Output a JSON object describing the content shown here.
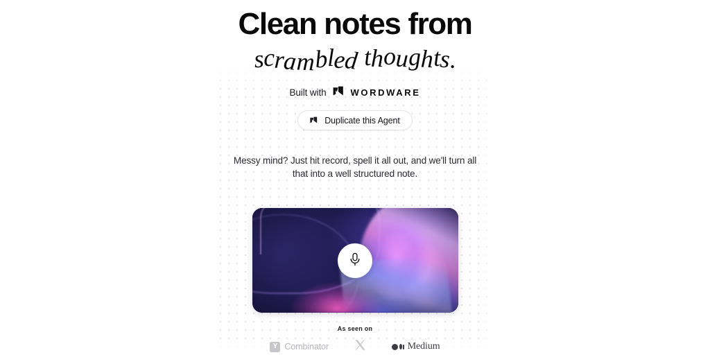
{
  "hero": {
    "headline_line1": "Clean notes from",
    "headline_line2": "scrambled thoughts.",
    "built_with_label": "Built with",
    "brand_name": "WORDWARE",
    "brand_mark_icon": "wordware-w-mark",
    "duplicate_button_label": "Duplicate this Agent",
    "duplicate_button_icon": "wordware-w-mark",
    "description": "Messy mind? Just hit record, spell it all out, and we'll turn all that into a well structured note."
  },
  "recorder": {
    "mic_button_icon": "microphone-icon",
    "background_colors": {
      "deep_navy": "#12102e",
      "indigo": "#2b2566",
      "violet": "#7b66ff",
      "lavender": "#ecbaff",
      "magenta": "#ff5dc8"
    }
  },
  "press": {
    "label": "As seen on",
    "logos": [
      {
        "name": "Y Combinator",
        "badge": "Y",
        "wordmark": "Combinator",
        "color": "#b6b6bb"
      },
      {
        "name": "X",
        "glyph": "𝕏",
        "color": "#c9c9ce"
      },
      {
        "name": "Medium",
        "wordmark": "Medium",
        "color": "#3c3c42"
      }
    ]
  }
}
